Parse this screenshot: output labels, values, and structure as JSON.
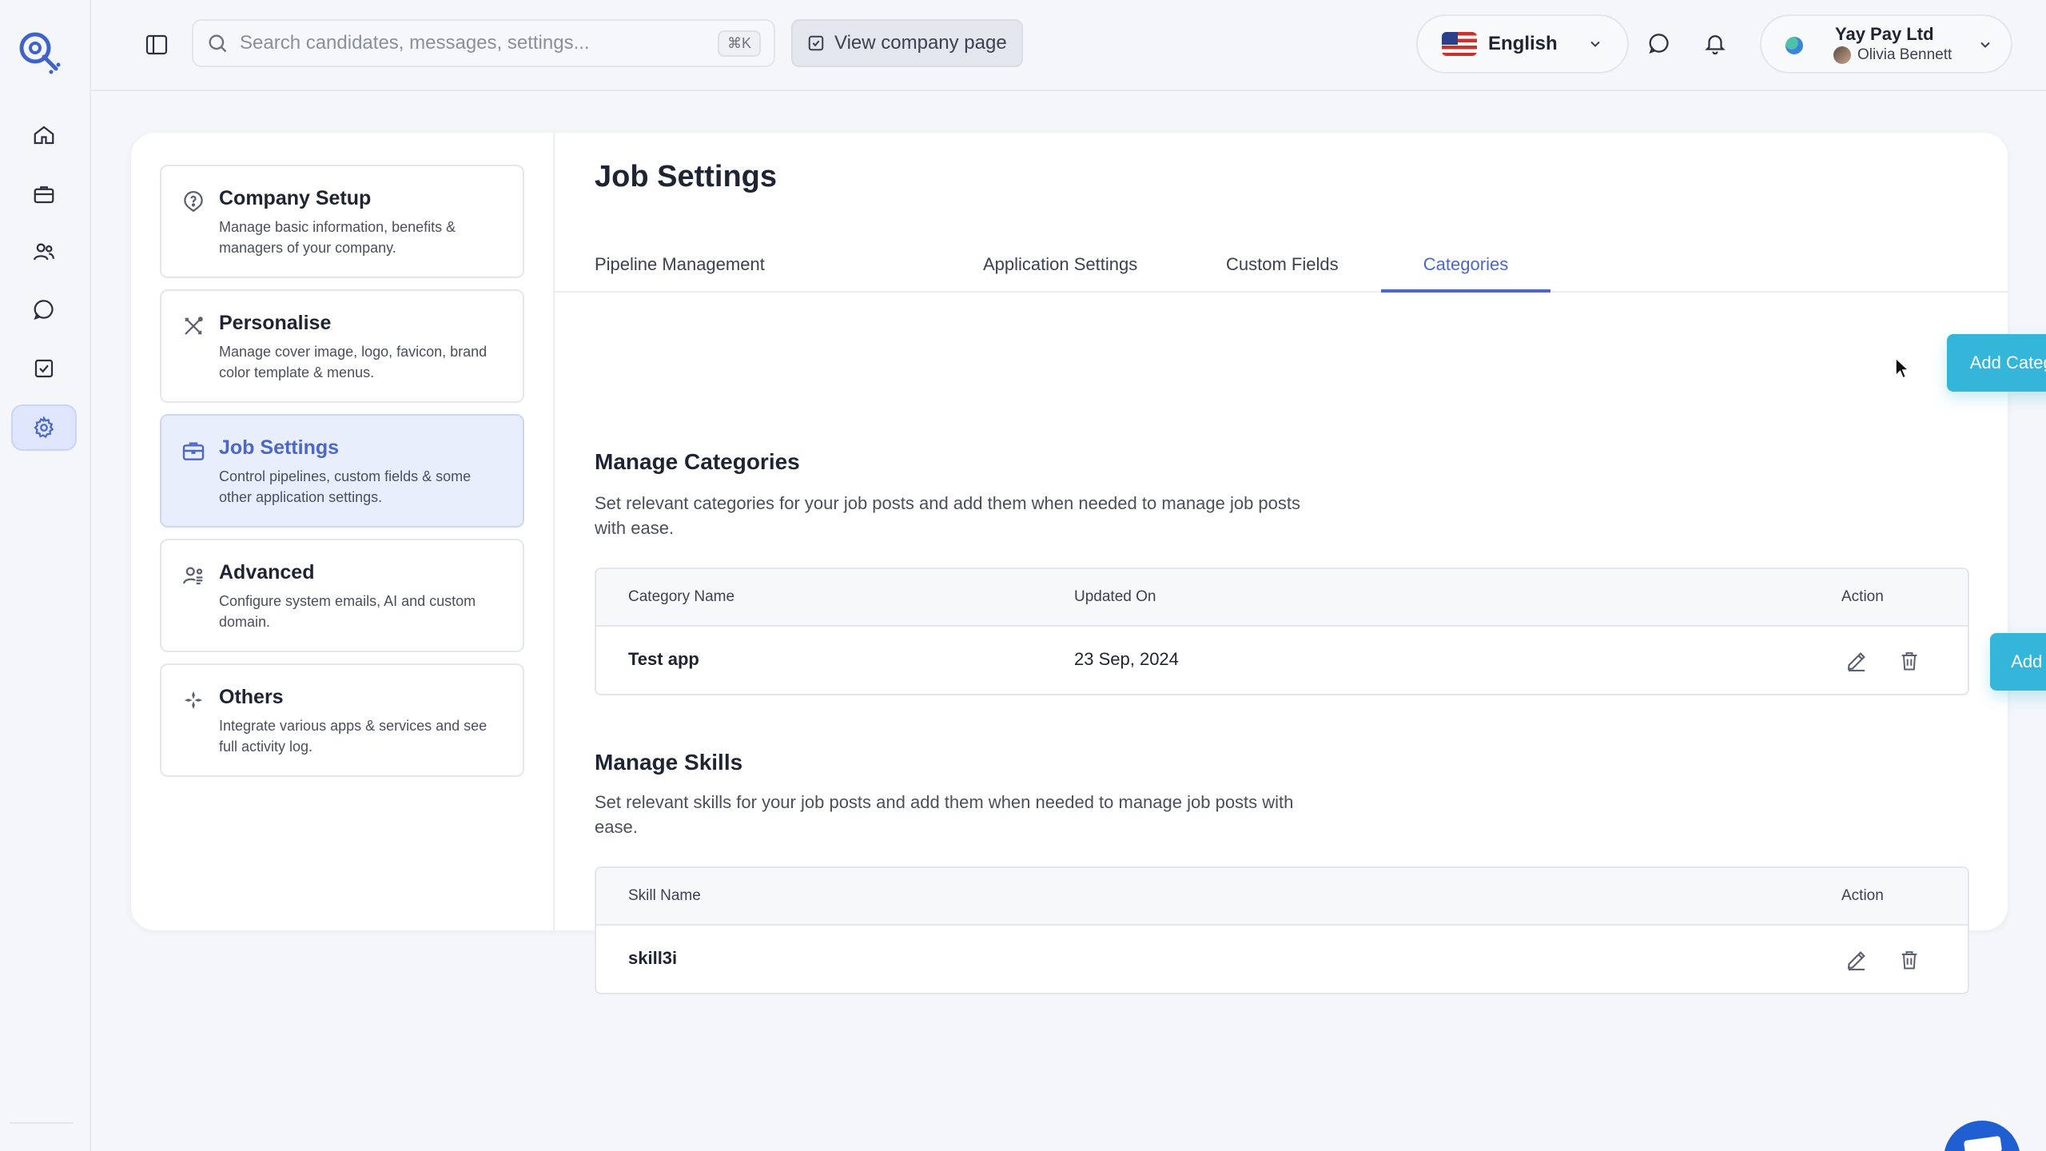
{
  "search": {
    "placeholder": "Search candidates, messages, settings...",
    "shortcut": "⌘K"
  },
  "header": {
    "view_company_label": "View company page",
    "language": "English",
    "company_name": "Yay Pay Ltd",
    "user_name": "Olivia Bennett"
  },
  "settings_nav": [
    {
      "title": "Company Setup",
      "desc": "Manage basic information, benefits & managers of your company."
    },
    {
      "title": "Personalise",
      "desc": "Manage cover image, logo, favicon, brand color template & menus."
    },
    {
      "title": "Job Settings",
      "desc": "Control pipelines, custom fields & some other application settings."
    },
    {
      "title": "Advanced",
      "desc": "Configure system emails, AI and custom domain."
    },
    {
      "title": "Others",
      "desc": "Integrate various apps & services and see full activity log."
    }
  ],
  "page": {
    "title": "Job Settings",
    "tabs": [
      "Pipeline Management",
      "Application Settings",
      "Custom Fields",
      "Categories"
    ],
    "active_tab": "Categories"
  },
  "categories": {
    "title": "Manage Categories",
    "desc": "Set relevant categories for your job posts and add them when needed to manage job posts with ease.",
    "add_label": "Add Category",
    "columns": [
      "Category Name",
      "Updated On",
      "Action"
    ],
    "rows": [
      {
        "name": "Test app",
        "updated": "23 Sep, 2024"
      }
    ]
  },
  "skills": {
    "title": "Manage Skills",
    "desc": "Set relevant skills for your job posts and add them when needed to manage job posts with ease.",
    "add_label": "Add Skill",
    "columns": [
      "Skill Name",
      "Action"
    ],
    "rows": [
      {
        "name": "skill3i"
      }
    ]
  },
  "colors": {
    "accent": "#4a67c9",
    "primary_button": "#33b6d9",
    "active_nav_bg": "#e8eefc"
  },
  "icons": {
    "rail": [
      "home-icon",
      "briefcase-icon",
      "users-icon",
      "chat-icon",
      "checklist-icon",
      "gear-icon"
    ],
    "settings_nav": [
      "question-badge-icon",
      "brush-ruler-icon",
      "briefcase-icon",
      "user-gear-icon",
      "sparkles-icon"
    ],
    "row_actions": [
      "pencil-icon",
      "trash-icon"
    ]
  }
}
